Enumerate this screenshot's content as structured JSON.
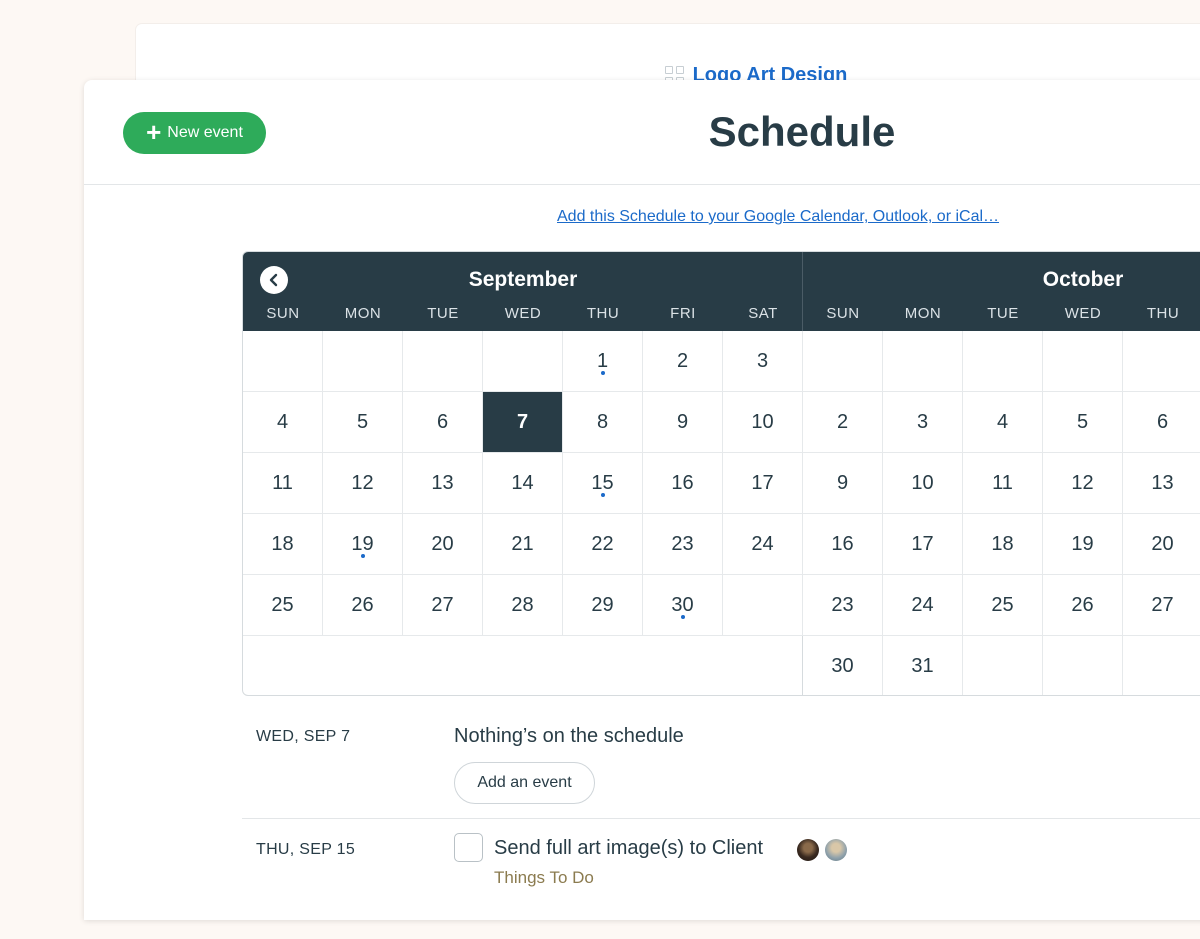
{
  "project": {
    "name": "Logo Art Design",
    "icon": "grid-icon"
  },
  "header": {
    "new_event_label": "New event",
    "title": "Schedule"
  },
  "subscribe_link": "Add this Schedule to your Google Calendar, Outlook, or iCal…",
  "calendar": {
    "weekdays": [
      "SUN",
      "MON",
      "TUE",
      "WED",
      "THU",
      "FRI",
      "SAT"
    ],
    "months": [
      {
        "name": "September",
        "weeks": [
          [
            "",
            "",
            "",
            "",
            "1",
            "2",
            "3"
          ],
          [
            "4",
            "5",
            "6",
            "7",
            "8",
            "9",
            "10"
          ],
          [
            "11",
            "12",
            "13",
            "14",
            "15",
            "16",
            "17"
          ],
          [
            "18",
            "19",
            "20",
            "21",
            "22",
            "23",
            "24"
          ],
          [
            "25",
            "26",
            "27",
            "28",
            "29",
            "30",
            ""
          ]
        ],
        "selected_day": "7",
        "event_days": [
          "1",
          "15",
          "19",
          "30"
        ]
      },
      {
        "name": "October",
        "weeks": [
          [
            "",
            "",
            "",
            "",
            ""
          ],
          [
            "2",
            "3",
            "4",
            "5",
            "6"
          ],
          [
            "9",
            "10",
            "11",
            "12",
            "13"
          ],
          [
            "16",
            "17",
            "18",
            "19",
            "20"
          ],
          [
            "23",
            "24",
            "25",
            "26",
            "27"
          ],
          [
            "30",
            "31",
            "",
            "",
            ""
          ]
        ]
      }
    ],
    "colors": {
      "header_bg": "#283c46",
      "selected_bg": "#283c46",
      "event_dot": "#1b6ac9"
    }
  },
  "agenda": [
    {
      "date": "WED, SEP 7",
      "message": "Nothing’s on the schedule",
      "add_button": "Add an event"
    },
    {
      "date": "THU, SEP 15",
      "todo": {
        "title": "Send full art image(s) to Client",
        "list": "Things To Do",
        "checked": false
      }
    }
  ],
  "accent_colors": {
    "new_event_button": "#2eab5a",
    "link": "#1b6ac9",
    "todo_list": "#8b7b4f"
  }
}
